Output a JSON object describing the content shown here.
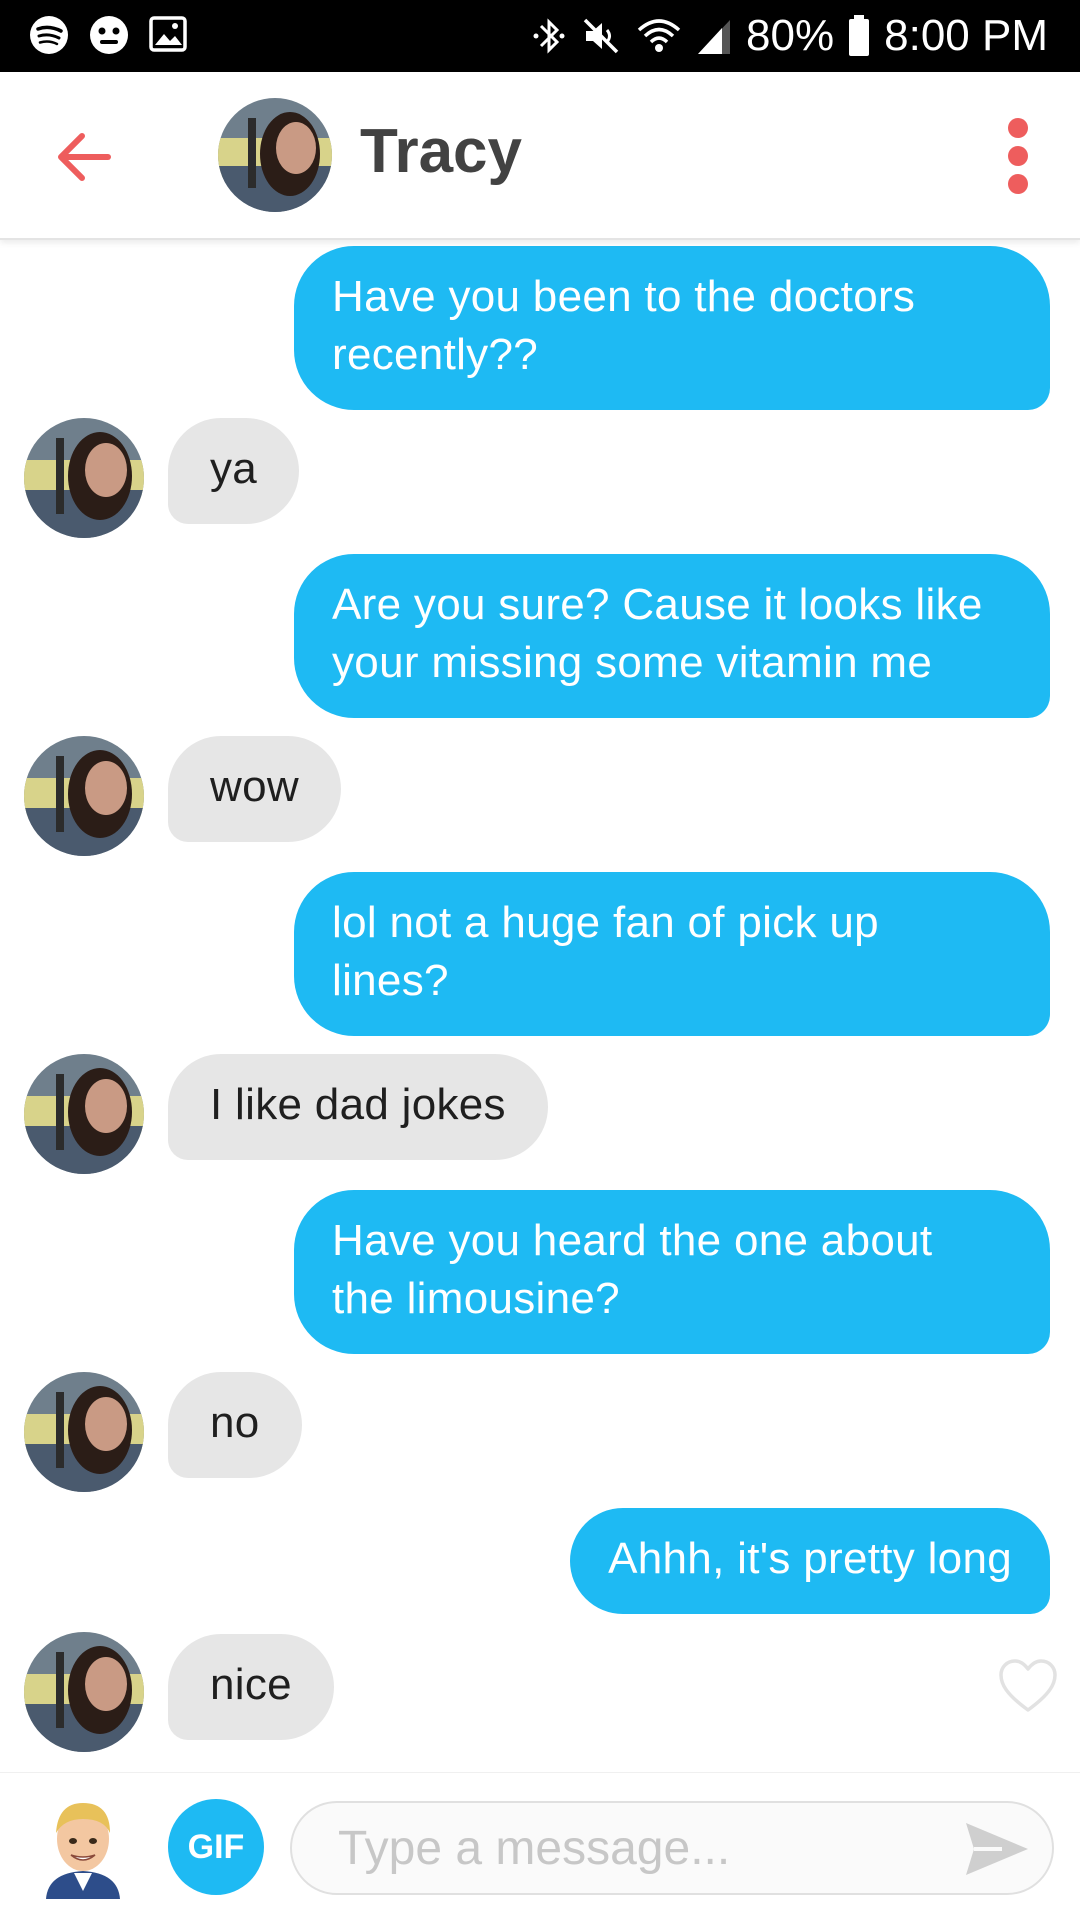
{
  "status_bar": {
    "battery": "80%",
    "time": "8:00 PM",
    "icons": [
      "spotify-icon",
      "face-icon",
      "image-icon",
      "bluetooth-icon",
      "mute-icon",
      "wifi-icon",
      "signal-icon",
      "battery-icon"
    ]
  },
  "header": {
    "contact_name": "Tracy",
    "back_icon": "back-arrow-icon",
    "menu_icon": "more-vertical-icon"
  },
  "messages": [
    {
      "from": "me",
      "text": "Have you been to the doctors recently??"
    },
    {
      "from": "them",
      "text": "ya"
    },
    {
      "from": "me",
      "text": "Are you sure? Cause it looks like your missing some vitamin me"
    },
    {
      "from": "them",
      "text": "wow"
    },
    {
      "from": "me",
      "text": "lol not a huge fan of pick up lines?"
    },
    {
      "from": "them",
      "text": "I like dad jokes"
    },
    {
      "from": "me",
      "text": "Have you heard the one about the limousine?"
    },
    {
      "from": "them",
      "text": "no"
    },
    {
      "from": "me",
      "text": "Ahhh, it's pretty long"
    },
    {
      "from": "them",
      "text": "nice"
    }
  ],
  "composer": {
    "gif_label": "GIF",
    "placeholder": "Type a message...",
    "send_icon": "send-icon"
  },
  "colors": {
    "sent_bubble": "#1ebaf3",
    "received_bubble": "#e6e6e6",
    "accent_red": "#ee5d5d"
  }
}
